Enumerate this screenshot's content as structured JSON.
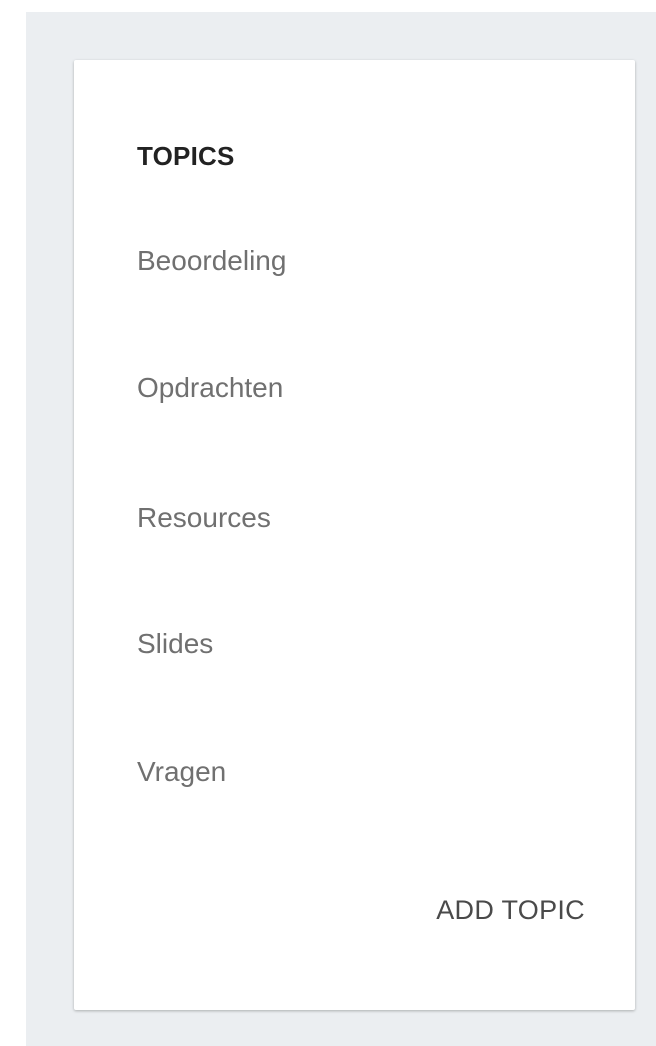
{
  "topics_panel": {
    "heading": "TOPICS",
    "items": [
      {
        "label": "Beoordeling"
      },
      {
        "label": "Opdrachten"
      },
      {
        "label": "Resources"
      },
      {
        "label": "Slides"
      },
      {
        "label": "Vragen"
      }
    ],
    "add_button_label": "ADD TOPIC"
  },
  "colors": {
    "page_background": "#ebeef1",
    "card_background": "#ffffff",
    "heading_text": "#222222",
    "item_text": "#707070",
    "button_text": "#4a4a4a"
  }
}
